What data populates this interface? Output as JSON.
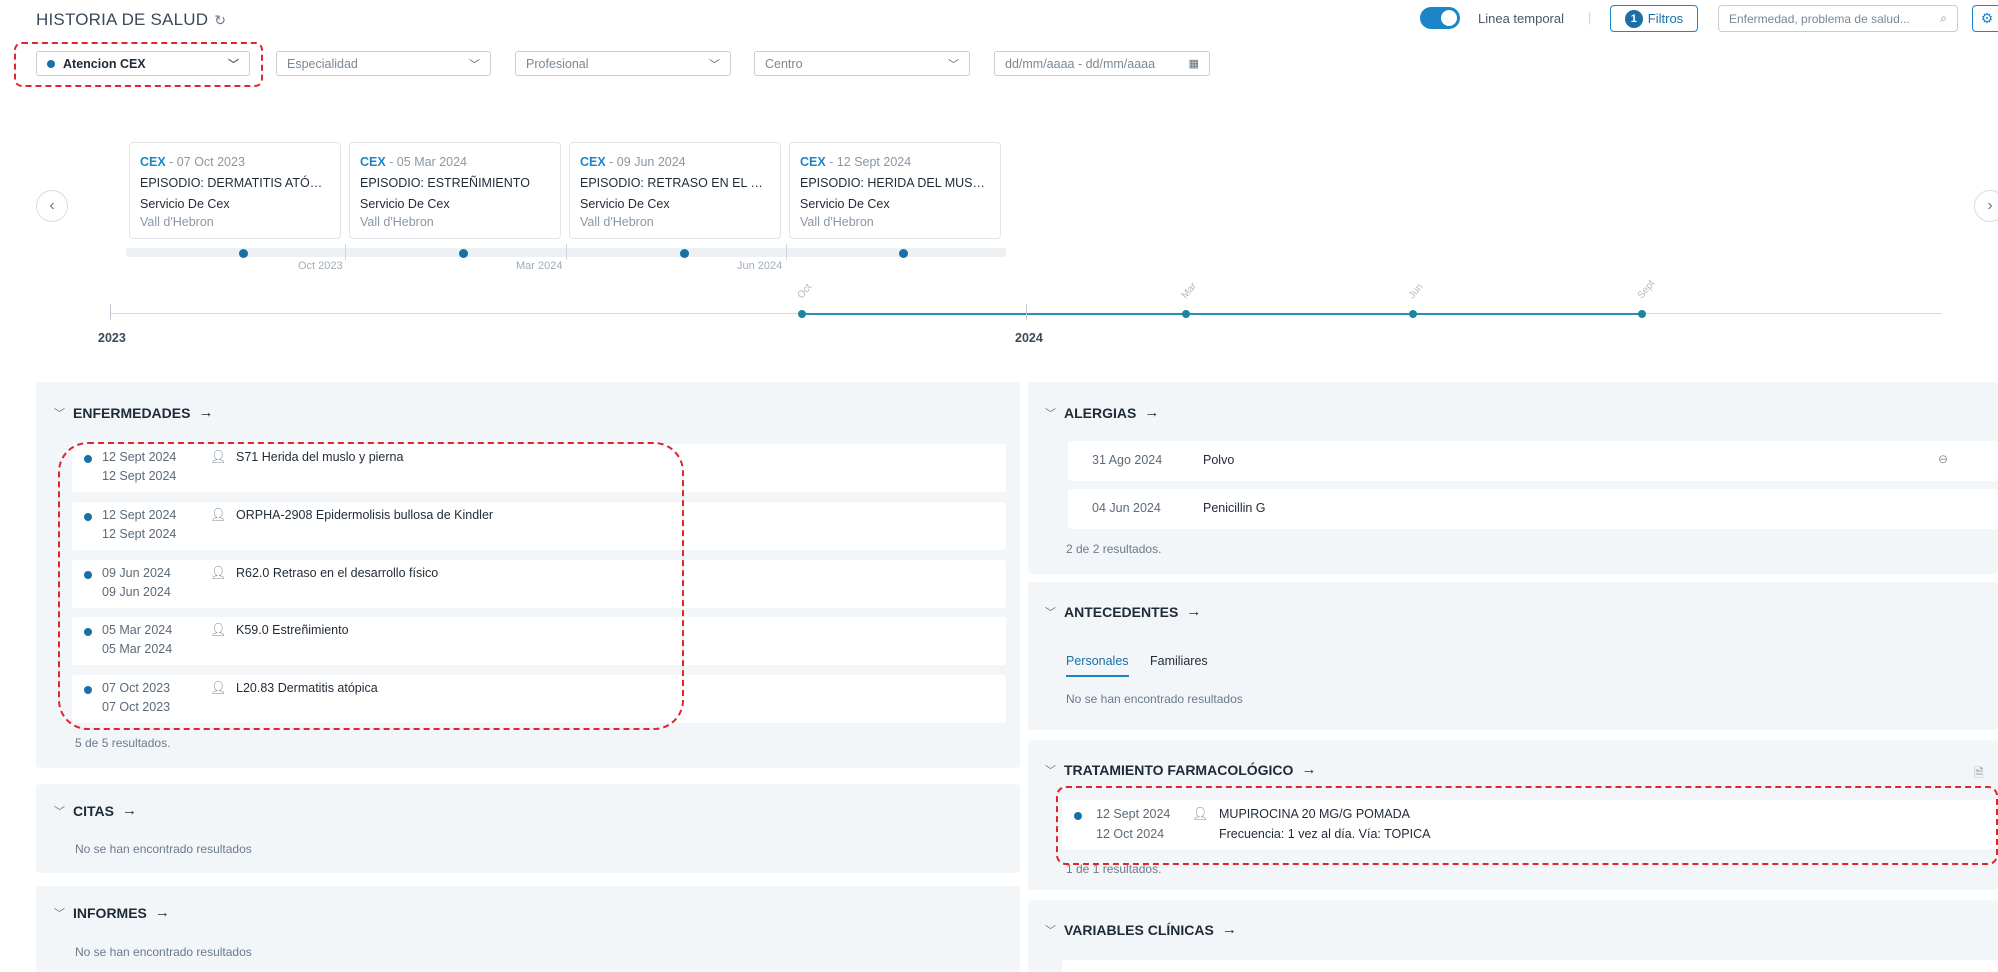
{
  "header": {
    "title": "HISTORIA DE SALUD",
    "refresh_icon": "refresh-icon",
    "timeline_toggle_label": "Linea temporal",
    "filters_button_label": "Filtros",
    "filters_count": "1",
    "search_placeholder": "Enfermedad, problema de salud...",
    "accent_color": "#1a86c8"
  },
  "filters": {
    "care_type": "Atencion CEX",
    "specialty": "Especialidad",
    "professional": "Profesional",
    "center": "Centro",
    "date_range": "dd/mm/aaaa - dd/mm/aaaa"
  },
  "timeline": {
    "cards": [
      {
        "type": "CEX",
        "date": " - 07 Oct 2023",
        "episode": "EPISODIO: DERMATITIS ATÓPICA",
        "service": "Servicio De Cex",
        "center": "Vall d'Hebron",
        "bar_label": "Oct 2023"
      },
      {
        "type": "CEX",
        "date": " - 05 Mar 2024",
        "episode": "EPISODIO: ESTREÑIMIENTO",
        "service": "Servicio De Cex",
        "center": "Vall d'Hebron",
        "bar_label": "Mar 2024"
      },
      {
        "type": "CEX",
        "date": " - 09 Jun 2024",
        "episode": "EPISODIO: RETRASO EN EL DES...",
        "service": "Servicio De Cex",
        "center": "Vall d'Hebron",
        "bar_label": "Jun 2024"
      },
      {
        "type": "CEX",
        "date": " - 12 Sept 2024",
        "episode": "EPISODIO: HERIDA DEL MUSLO ...",
        "service": "Servicio De Cex",
        "center": "Vall d'Hebron",
        "bar_label": ""
      }
    ],
    "axis": {
      "years": [
        "2023",
        "2024"
      ],
      "months": [
        "Oct",
        "Mar",
        "Jun",
        "Sept"
      ]
    }
  },
  "enfermedades": {
    "title": "ENFERMEDADES",
    "items": [
      {
        "date1": "12 Sept 2024",
        "date2": "12 Sept 2024",
        "text": "S71 Herida del muslo y pierna"
      },
      {
        "date1": "12 Sept 2024",
        "date2": "12 Sept 2024",
        "text": "ORPHA-2908 Epidermolisis bullosa de Kindler"
      },
      {
        "date1": "09 Jun 2024",
        "date2": "09 Jun 2024",
        "text": "R62.0 Retraso en el desarrollo físico"
      },
      {
        "date1": "05 Mar 2024",
        "date2": "05 Mar 2024",
        "text": "K59.0 Estreñimiento"
      },
      {
        "date1": "07 Oct 2023",
        "date2": "07 Oct 2023",
        "text": "L20.83 Dermatitis atópica"
      }
    ],
    "count": "5 de 5 resultados."
  },
  "citas": {
    "title": "CITAS",
    "empty": "No se han encontrado resultados"
  },
  "informes": {
    "title": "INFORMES",
    "empty": "No se han encontrado resultados"
  },
  "alergias": {
    "title": "ALERGIAS",
    "items": [
      {
        "date": "31 Ago 2024",
        "text": "Polvo"
      },
      {
        "date": "04 Jun 2024",
        "text": "Penicillin G"
      }
    ],
    "count": "2 de 2 resultados."
  },
  "antecedentes": {
    "title": "ANTECEDENTES",
    "tabs": [
      "Personales",
      "Familiares"
    ],
    "empty": "No se han encontrado resultados"
  },
  "tratamiento": {
    "title": "TRATAMIENTO FARMACOLÓGICO",
    "items": [
      {
        "date1": "12 Sept 2024",
        "date2": "12 Oct 2024",
        "text": "MUPIROCINA 20 MG/G POMADA",
        "detail": "Frecuencia: 1 vez al día. Vía: TOPICA"
      }
    ],
    "count": "1 de 1 resultados."
  },
  "variables": {
    "title": "VARIABLES CLÍNICAS"
  }
}
